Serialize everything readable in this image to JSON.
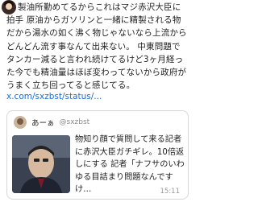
{
  "post": {
    "body": "製油所勤めてるからこれはマジ赤沢大臣に拍手 原油からガソリンと一緒に精製される物だから湯水の如く沸く物じゃないなら上流からどんどん流す事なんて出来ない。 中東問題でタンカー減ると言われ続けてるけど3ヶ月経った今でも精油量はほぼ変わってないから政府がうまく立ち回ってると感じてる。",
    "link": "x.com/sxzbst/status/..."
  },
  "quoted": {
    "name": "あーぁ",
    "handle": "@sxzbst",
    "text": "物知り顔で質問して来る記者に赤沢大臣ガチギレ。10倍返しにする 記者「ナフサのいわゆる目詰まり問題なんですけ…",
    "time": "15:11"
  }
}
